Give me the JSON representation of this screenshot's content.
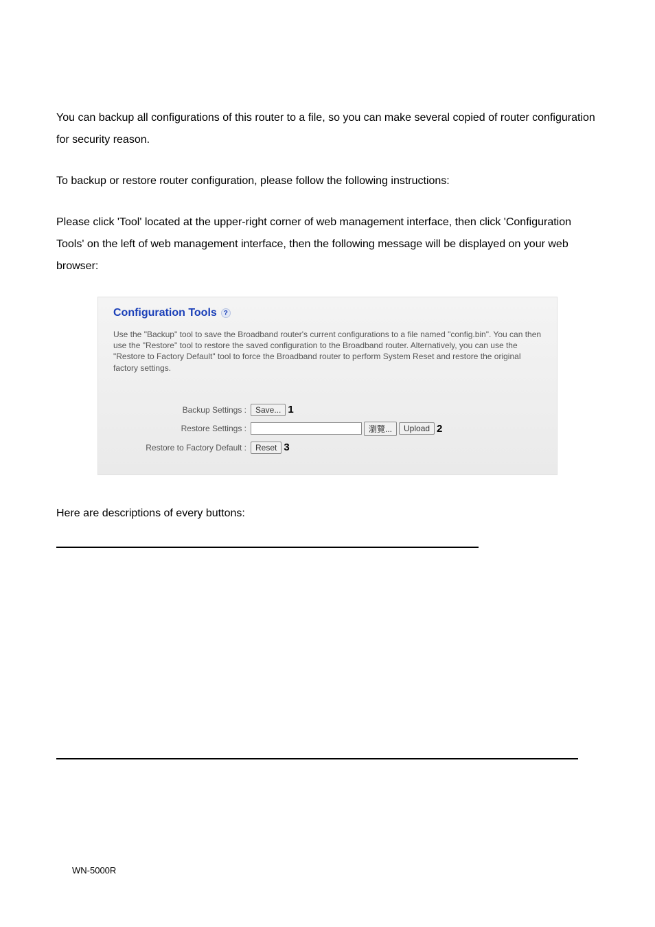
{
  "doc": {
    "p1": "You can backup all configurations of this router to a file, so you can make several copied of router configuration for security reason.",
    "p2": "To backup or restore router configuration, please follow the following instructions:",
    "p3": "Please click 'Tool' located at the upper-right corner of web management interface, then click 'Configuration Tools' on the left of web management interface, then the following message will be displayed on your web browser:",
    "p4": "Here are descriptions of every buttons:",
    "footer": "WN-5000R"
  },
  "panel": {
    "title": "Configuration Tools",
    "help_glyph": "?",
    "desc": "Use the \"Backup\" tool to save the Broadband router's current configurations to a file named \"config.bin\". You can then use the \"Restore\" tool to restore the saved configuration to the Broadband router. Alternatively, you can use the \"Restore to Factory Default\" tool to force the Broadband router to perform System Reset and restore the original factory settings.",
    "rows": {
      "backup": {
        "label": "Backup Settings :",
        "button": "Save...",
        "ann": "1"
      },
      "restore": {
        "label": "Restore Settings :",
        "browse": "瀏覽...",
        "upload": "Upload",
        "ann": "2"
      },
      "reset": {
        "label": "Restore to Factory Default :",
        "button": "Reset",
        "ann": "3"
      }
    }
  }
}
